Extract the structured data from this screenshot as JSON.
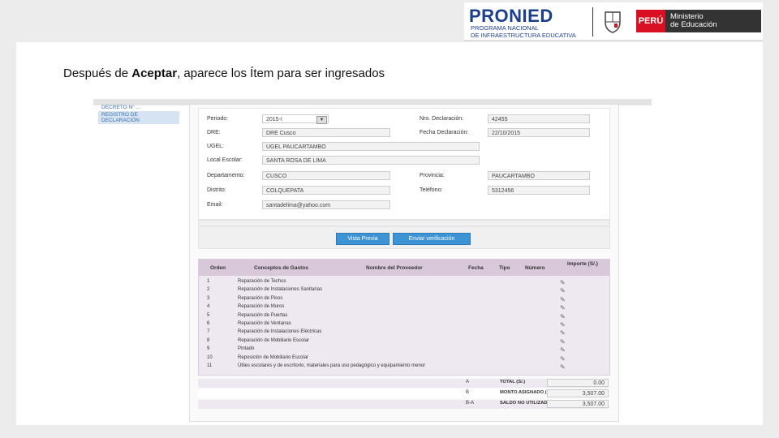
{
  "header": {
    "pronied_logo": "PRONIED",
    "pronied_sub_line1": "PROGRAMA NACIONAL",
    "pronied_sub_line2": "DE INFRAESTRUCTURA EDUCATIVA",
    "peru_label": "PERÚ",
    "ministry_line1": "Ministerio",
    "ministry_line2": "de Educación"
  },
  "caption": {
    "prefix": "Después de ",
    "bold": "Aceptar",
    "suffix": ", aparece los Ítem para ser ingresados"
  },
  "nav": {
    "items": [
      "DECRETO N° ...",
      "REGISTRO DE DECLARACIÓN"
    ]
  },
  "form": {
    "periodo_label": "Periodo:",
    "periodo_value": "2015-I",
    "nro_label": "Nro. Declaración:",
    "nro_value": "42455",
    "dre_label": "DRE:",
    "dre_value": "DRE Cusco",
    "fecha_label": "Fecha Declaración:",
    "fecha_value": "22/10/2015",
    "ugel_label": "UGEL:",
    "ugel_value": "UGEL PAUCARTAMBO",
    "local_label": "Local Escolar:",
    "local_value": "SANTA ROSA DE LIMA",
    "depto_label": "Departamento:",
    "depto_value": "CUSCO",
    "prov_label": "Provincia:",
    "prov_value": "PAUCARTAMBO",
    "distrito_label": "Distrito:",
    "distrito_value": "COLQUEPATA",
    "tel_label": "Teléfono:",
    "tel_value": "5312456",
    "email_label": "Email:",
    "email_value": "santadelima@yahoo.com"
  },
  "buttons": {
    "preview": "Vista Previa",
    "send": "Enviar verificación"
  },
  "table": {
    "headers": {
      "orden": "Orden",
      "conceptos": "Conceptos de Gastos",
      "proveedor": "Nombre del Proveedor",
      "fecha": "Fecha",
      "tipo": "Tipo",
      "numero": "Número",
      "importe": "Importe (S/.)"
    },
    "rows": [
      {
        "n": "1",
        "concepto": "Reparación de Techos"
      },
      {
        "n": "2",
        "concepto": "Reparación de Instalaciones Sanitarias"
      },
      {
        "n": "3",
        "concepto": "Reparación de Pisos"
      },
      {
        "n": "4",
        "concepto": "Reparación de Muros"
      },
      {
        "n": "5",
        "concepto": "Reparación de Puertas"
      },
      {
        "n": "6",
        "concepto": "Reparación de Ventanas"
      },
      {
        "n": "7",
        "concepto": "Reparación de Instalaciones Eléctricas"
      },
      {
        "n": "8",
        "concepto": "Reparación de Mobiliario Escolar"
      },
      {
        "n": "9",
        "concepto": "Pintado"
      },
      {
        "n": "10",
        "concepto": "Reposición de Mobiliario Escolar"
      },
      {
        "n": "11",
        "concepto": "Útiles escolares y de escritorio, materiales para uso pedagógico y equipamiento menor"
      }
    ]
  },
  "totals": {
    "a_code": "A",
    "a_label": "TOTAL (S/.)",
    "a_value": "0.00",
    "b_code": "B",
    "b_label": "MONTO ASIGNADO (S/.)",
    "b_value": "3,507.00",
    "c_code": "B-A",
    "c_label": "SALDO NO UTILIZADO (S/.)",
    "c_value": "3,507.00"
  }
}
